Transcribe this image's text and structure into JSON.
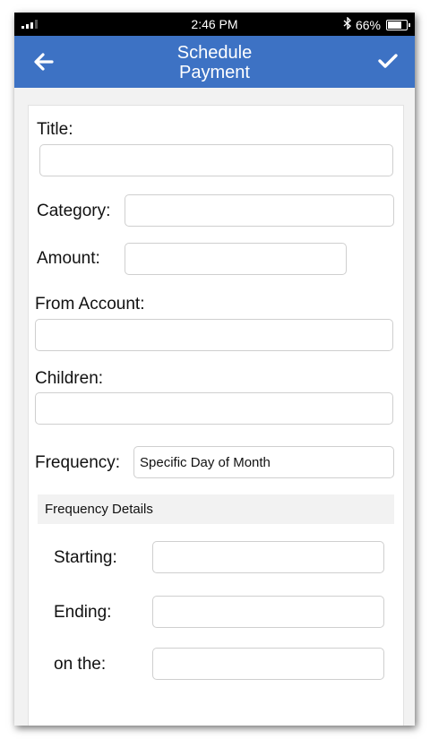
{
  "status_bar": {
    "time": "2:46 PM",
    "battery": "66%",
    "icons": [
      "signal-icon",
      "bluetooth-icon",
      "battery-icon"
    ]
  },
  "nav": {
    "title_line1": "Schedule",
    "title_line2": "Payment",
    "back_icon": "arrow-left-icon",
    "done_icon": "checkmark-icon"
  },
  "form": {
    "title_label": "Title:",
    "title_value": "",
    "category_label": "Category:",
    "category_value": "",
    "amount_label": "Amount:",
    "amount_value": "",
    "from_account_label": "From Account:",
    "from_account_value": "",
    "children_label": "Children:",
    "children_value": "",
    "frequency_label": "Frequency:",
    "frequency_value": "Specific Day of Month",
    "frequency_details_header": "Frequency Details",
    "starting_label": "Starting:",
    "starting_value": "",
    "ending_label": "Ending:",
    "ending_value": "",
    "on_the_label": "on the:",
    "on_the_value": ""
  },
  "colors": {
    "nav_blue": "#3d72c4",
    "status_black": "#000000",
    "background_gray": "#f2f2f2"
  }
}
